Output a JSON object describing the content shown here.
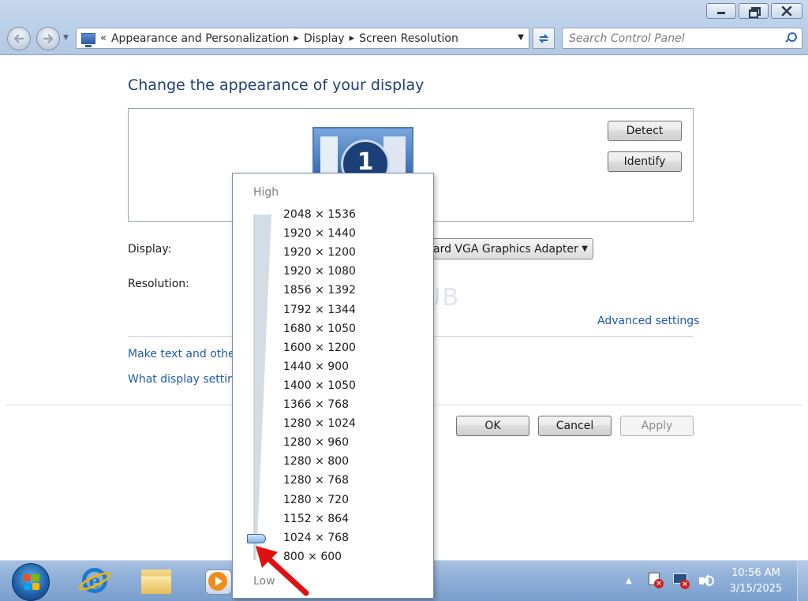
{
  "window": {
    "caption_buttons": [
      "minimize",
      "maximize",
      "close"
    ]
  },
  "nav": {
    "back_icon": "back-arrow-icon",
    "forward_icon": "forward-arrow-icon"
  },
  "address": {
    "overflow": "«",
    "crumbs": [
      "Appearance and Personalization",
      "Display",
      "Screen Resolution"
    ],
    "separator": "▸"
  },
  "search": {
    "placeholder": "Search Control Panel"
  },
  "main": {
    "title": "Change the appearance of your display",
    "monitor_number": "1",
    "detect_label": "Detect",
    "identify_label": "Identify",
    "display_label": "Display:",
    "display_value": "ard VGA Graphics Adapter",
    "resolution_label": "Resolution:",
    "advanced_link": "Advanced settings",
    "text_size_link": "Make text and other",
    "help_link": "What display setting",
    "watermark": "ITPros HUB"
  },
  "footer": {
    "ok_label": "OK",
    "cancel_label": "Cancel",
    "apply_label": "Apply"
  },
  "flyout": {
    "high_label": "High",
    "low_label": "Low",
    "selected": "1024 × 768",
    "options": [
      "2048 × 1536",
      "1920 × 1440",
      "1920 × 1200",
      "1920 × 1080",
      "1856 × 1392",
      "1792 × 1344",
      "1680 × 1050",
      "1600 × 1200",
      "1440 × 900",
      "1400 × 1050",
      "1366 × 768",
      "1280 × 1024",
      "1280 × 960",
      "1280 × 800",
      "1280 × 768",
      "1280 × 720",
      "1152 × 864",
      "1024 × 768",
      "800 × 600"
    ]
  },
  "taskbar": {
    "pinned": [
      "internet-explorer-icon",
      "windows-explorer-icon",
      "media-player-icon"
    ],
    "time": "10:56 AM",
    "date": "3/15/2025"
  },
  "colors": {
    "link": "#1e5aa8",
    "title": "#1e3f76",
    "annotation_arrow": "#e01010"
  }
}
